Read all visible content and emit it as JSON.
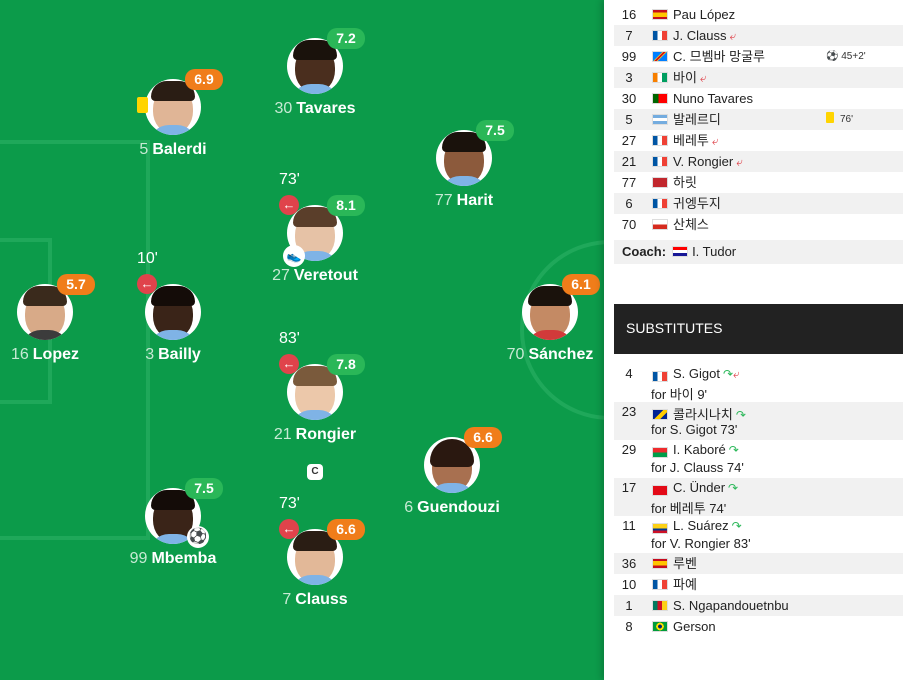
{
  "pitch_players": [
    {
      "number": "30",
      "name": "Tavares",
      "rating": "7.2",
      "rating_color": "green"
    },
    {
      "number": "5",
      "name": "Balerdi",
      "rating": "6.9",
      "rating_color": "orange"
    },
    {
      "number": "77",
      "name": "Harit",
      "rating": "7.5",
      "rating_color": "green"
    },
    {
      "number": "27",
      "name": "Veretout",
      "rating": "8.1",
      "rating_color": "green",
      "sub_minute": "73'"
    },
    {
      "number": "16",
      "name": "Lopez",
      "rating": "5.7",
      "rating_color": "orange"
    },
    {
      "number": "3",
      "name": "Bailly",
      "rating": "",
      "rating_color": "none",
      "sub_minute": "10'"
    },
    {
      "number": "70",
      "name": "Sánchez",
      "rating": "6.1",
      "rating_color": "orange"
    },
    {
      "number": "21",
      "name": "Rongier",
      "rating": "7.8",
      "rating_color": "green",
      "sub_minute": "83'",
      "captain_label": "C"
    },
    {
      "number": "6",
      "name": "Guendouzi",
      "rating": "6.6",
      "rating_color": "orange"
    },
    {
      "number": "99",
      "name": "Mbemba",
      "rating": "7.5",
      "rating_color": "green"
    },
    {
      "number": "7",
      "name": "Clauss",
      "rating": "6.6",
      "rating_color": "orange",
      "sub_minute": "73'"
    }
  ],
  "lineup": [
    {
      "no": "16",
      "name": "Pau López",
      "flag": "spain"
    },
    {
      "no": "7",
      "name": "J. Clauss",
      "flag": "france",
      "subbed_off": true
    },
    {
      "no": "99",
      "name": "C. 므벰바 망굴루",
      "flag": "dr-congo",
      "event": "45+2'",
      "event_icon": "ball-icon"
    },
    {
      "no": "3",
      "name": "바이",
      "flag": "ivory-coast",
      "subbed_off": true
    },
    {
      "no": "30",
      "name": "Nuno Tavares",
      "flag": "portugal"
    },
    {
      "no": "5",
      "name": "발레르디",
      "flag": "argentina",
      "event": "76'",
      "event_icon": "yellow-card-icon"
    },
    {
      "no": "27",
      "name": "베레투",
      "flag": "france",
      "subbed_off": true
    },
    {
      "no": "21",
      "name": "V. Rongier",
      "flag": "france",
      "subbed_off": true
    },
    {
      "no": "77",
      "name": "하릿",
      "flag": "morocco"
    },
    {
      "no": "6",
      "name": "귀엥두지",
      "flag": "france"
    },
    {
      "no": "70",
      "name": "산체스",
      "flag": "chile"
    }
  ],
  "coach": {
    "label": "Coach:",
    "name": "I. Tudor",
    "flag": "croatia"
  },
  "substitutes_header": "SUBSTITUTES",
  "substitutes": [
    {
      "no": "4",
      "name": "S. Gigot",
      "flag": "france",
      "for": "for 바이 9'",
      "in_out": true
    },
    {
      "no": "23",
      "name": "콜라시나치",
      "flag": "bosnia",
      "for": "for S. Gigot 73'"
    },
    {
      "no": "29",
      "name": "I. Kaboré",
      "flag": "burkina-faso",
      "for": "for J. Clauss 74'"
    },
    {
      "no": "17",
      "name": "C. Ünder",
      "flag": "turkey",
      "for": "for 베레투 74'"
    },
    {
      "no": "11",
      "name": "L. Suárez",
      "flag": "colombia",
      "for": "for V. Rongier 83'"
    }
  ],
  "unused_subs": [
    {
      "no": "36",
      "name": "루벤",
      "flag": "spain"
    },
    {
      "no": "10",
      "name": "파예",
      "flag": "france"
    },
    {
      "no": "1",
      "name": "S. Ngapandouetnbu",
      "flag": "cameroon"
    },
    {
      "no": "8",
      "name": "Gerson",
      "flag": "brazil"
    }
  ],
  "colors": {
    "pitch": "#0c9b4a",
    "rating_green": "#2ab758",
    "rating_orange": "#f07d1a",
    "sub_red": "#e0434b"
  }
}
